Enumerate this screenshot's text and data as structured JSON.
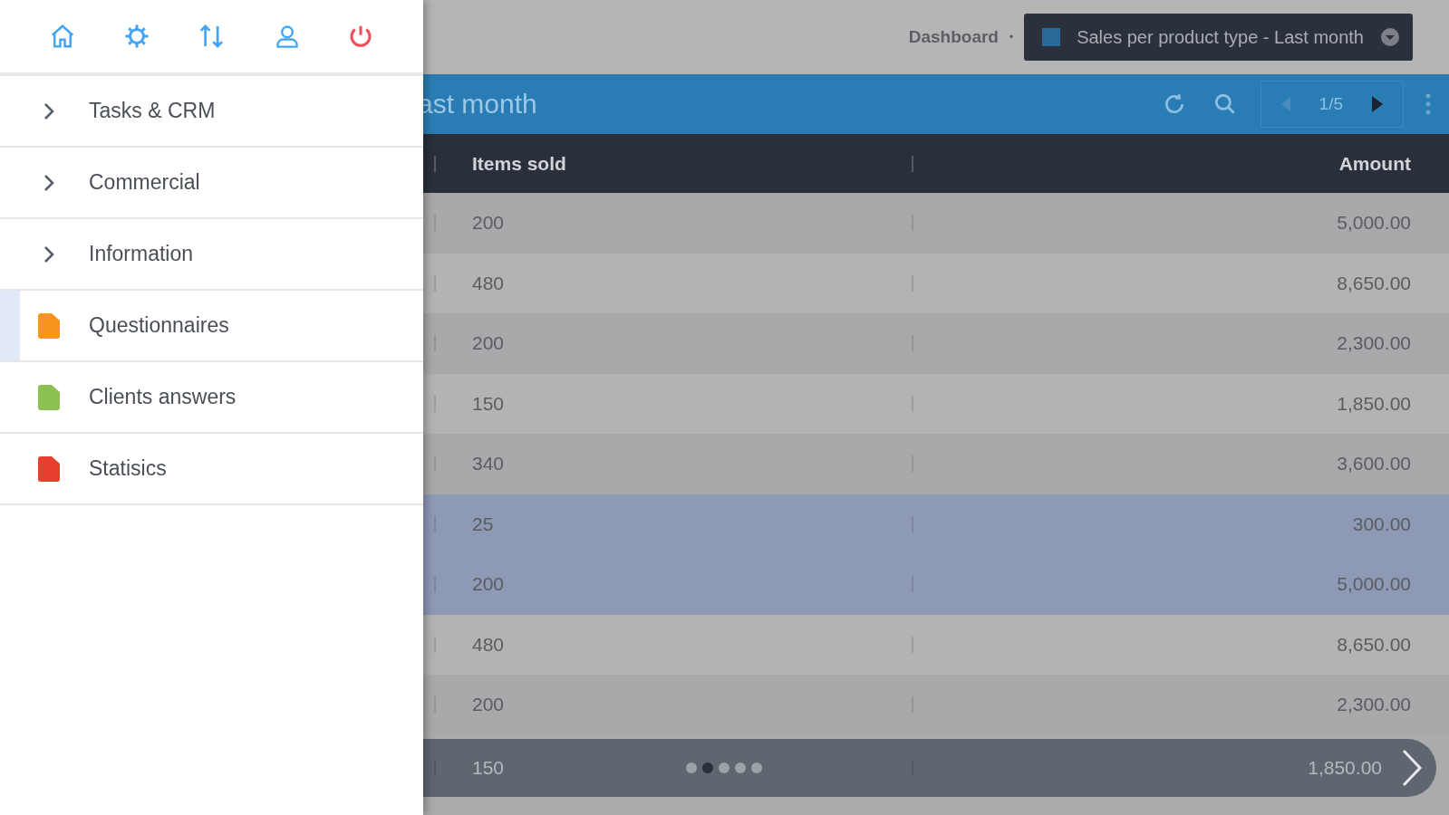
{
  "sidebar": {
    "menu": [
      {
        "kind": "group",
        "label": "Tasks & CRM",
        "selected": false
      },
      {
        "kind": "group",
        "label": "Commercial",
        "selected": false
      },
      {
        "kind": "group",
        "label": "Information",
        "selected": false
      },
      {
        "kind": "link",
        "label": "Questionnaires",
        "selected": true,
        "color": "#f7941d"
      },
      {
        "kind": "link",
        "label": "Clients answers",
        "selected": false,
        "color": "#8cc152"
      },
      {
        "kind": "link",
        "label": "Statisics",
        "selected": false,
        "color": "#e8402f"
      }
    ]
  },
  "breadcrumb": {
    "item": "Dashboard",
    "separator": "•",
    "current": "Sales per product type - Last month"
  },
  "panel": {
    "title": "ast month",
    "page": "1/5"
  },
  "table": {
    "columns": [
      "Items sold",
      "Amount"
    ],
    "rows": [
      {
        "items_sold": "200",
        "amount": "5,000.00",
        "selected": false
      },
      {
        "items_sold": "480",
        "amount": "8,650.00",
        "selected": false
      },
      {
        "items_sold": "200",
        "amount": "2,300.00",
        "selected": false
      },
      {
        "items_sold": "150",
        "amount": "1,850.00",
        "selected": false
      },
      {
        "items_sold": "340",
        "amount": "3,600.00",
        "selected": false
      },
      {
        "items_sold": "25",
        "amount": "300.00",
        "selected": true
      },
      {
        "items_sold": "200",
        "amount": "5,000.00",
        "selected": true
      },
      {
        "items_sold": "480",
        "amount": "8,650.00",
        "selected": false
      },
      {
        "items_sold": "200",
        "amount": "2,300.00",
        "selected": false
      },
      {
        "items_sold": "150",
        "amount": "1,850.00",
        "selected": false
      }
    ]
  },
  "pager_dots": [
    {
      "selected": false
    },
    {
      "selected": true
    },
    {
      "selected": false
    },
    {
      "selected": false
    },
    {
      "selected": false
    }
  ]
}
